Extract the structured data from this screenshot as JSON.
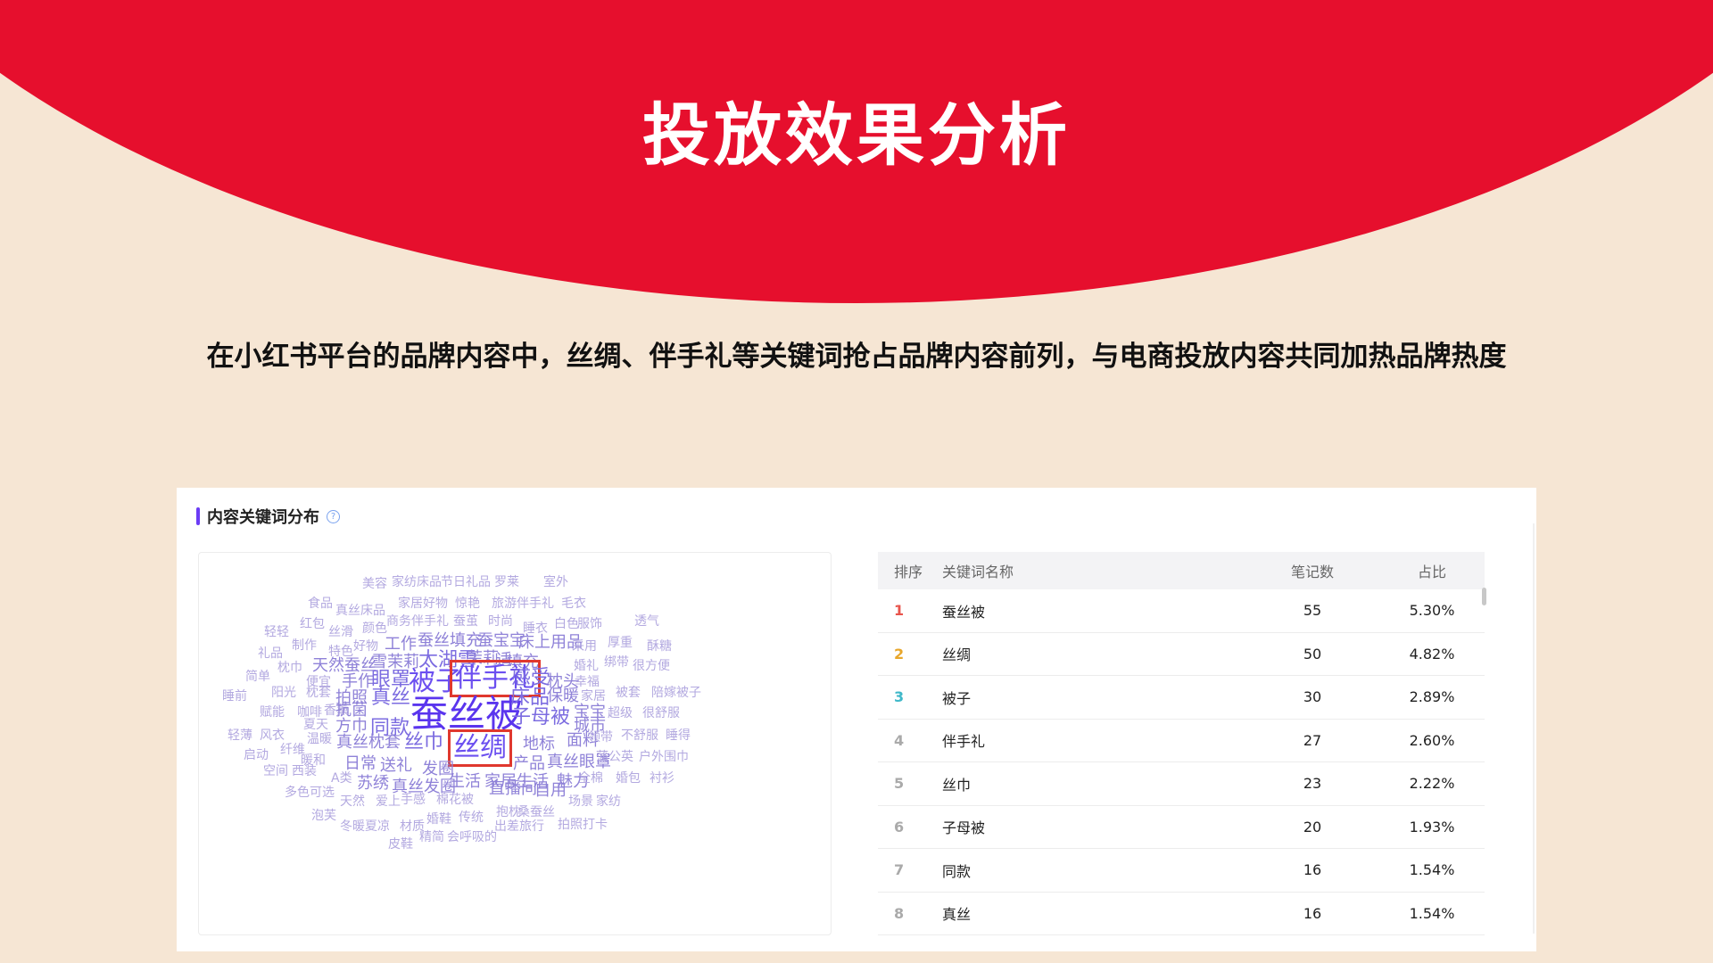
{
  "title": "投放效果分析",
  "subtitle": "在小红书平台的品牌内容中，丝绸、伴手礼等关键词抢占品牌内容前列，与电商投放内容共同加热品牌热度",
  "panel": {
    "title": "内容关键词分布",
    "help_icon": "question-circle-icon"
  },
  "colors": {
    "header_red": "#e60f2d",
    "background": "#f6e6d4",
    "accent_purple": "#6b3cf5",
    "highlight_box": "#e0382e"
  },
  "word_cloud": {
    "words": [
      {
        "t": "美容",
        "w": 1
      },
      {
        "t": "家纺床品",
        "w": 1
      },
      {
        "t": "节日礼品",
        "w": 1
      },
      {
        "t": "罗莱",
        "w": 1
      },
      {
        "t": "室外",
        "w": 1
      },
      {
        "t": "食品",
        "w": 1
      },
      {
        "t": "真丝床品",
        "w": 1
      },
      {
        "t": "家居好物",
        "w": 1
      },
      {
        "t": "惊艳",
        "w": 1
      },
      {
        "t": "旅游伴手礼",
        "w": 1
      },
      {
        "t": "毛衣",
        "w": 1
      },
      {
        "t": "轻轻",
        "w": 1
      },
      {
        "t": "红包",
        "w": 1
      },
      {
        "t": "商务伴手礼",
        "w": 1
      },
      {
        "t": "蚕茧",
        "w": 1
      },
      {
        "t": "时尚",
        "w": 1
      },
      {
        "t": "透气",
        "w": 1
      },
      {
        "t": "丝滑",
        "w": 1
      },
      {
        "t": "颜色",
        "w": 1
      },
      {
        "t": "睡衣",
        "w": 1
      },
      {
        "t": "白色",
        "w": 1
      },
      {
        "t": "服饰",
        "w": 1
      },
      {
        "t": "礼品",
        "w": 1
      },
      {
        "t": "制作",
        "w": 1
      },
      {
        "t": "好物",
        "w": 1
      },
      {
        "t": "工作",
        "w": 2
      },
      {
        "t": "蚕丝填充",
        "w": 2
      },
      {
        "t": "蚕宝宝",
        "w": 2
      },
      {
        "t": "床上用品",
        "w": 2
      },
      {
        "t": "厚重",
        "w": 1
      },
      {
        "t": "特色",
        "w": 1
      },
      {
        "t": "采用",
        "w": 1
      },
      {
        "t": "酥糖",
        "w": 1
      },
      {
        "t": "枕巾",
        "w": 1
      },
      {
        "t": "天然蚕丝",
        "w": 2
      },
      {
        "t": "雪茉莉",
        "w": 2
      },
      {
        "t": "太湖雪",
        "w": 3
      },
      {
        "t": "茉莉",
        "w": 2
      },
      {
        "t": "适",
        "w": 2
      },
      {
        "t": "填充",
        "w": 2
      },
      {
        "t": "婚礼",
        "w": 1
      },
      {
        "t": "绑带",
        "w": 1
      },
      {
        "t": "很方便",
        "w": 1
      },
      {
        "t": "简单",
        "w": 1
      },
      {
        "t": "便宜",
        "w": 1
      },
      {
        "t": "手作",
        "w": 2
      },
      {
        "t": "眼罩",
        "w": 3
      },
      {
        "t": "被子",
        "w": 4
      },
      {
        "t": "伴手礼",
        "w": 4
      },
      {
        "t": "感受",
        "w": 3
      },
      {
        "t": "枕头",
        "w": 2
      },
      {
        "t": "幸福",
        "w": 1
      },
      {
        "t": "睡前",
        "w": 1
      },
      {
        "t": "阳光",
        "w": 1
      },
      {
        "t": "枕套",
        "w": 1
      },
      {
        "t": "拍照",
        "w": 2
      },
      {
        "t": "真丝",
        "w": 3
      },
      {
        "t": "蚕丝被",
        "w": 5
      },
      {
        "t": "床品",
        "w": 3
      },
      {
        "t": "保暖",
        "w": 2
      },
      {
        "t": "家居",
        "w": 1
      },
      {
        "t": "被套",
        "w": 1
      },
      {
        "t": "陪嫁被子",
        "w": 1
      },
      {
        "t": "赋能",
        "w": 1
      },
      {
        "t": "咖啡",
        "w": 1
      },
      {
        "t": "香薰",
        "w": 1
      },
      {
        "t": "抗菌",
        "w": 2
      },
      {
        "t": "子母被",
        "w": 3
      },
      {
        "t": "宝宝",
        "w": 2
      },
      {
        "t": "超级",
        "w": 1
      },
      {
        "t": "很舒服",
        "w": 1
      },
      {
        "t": "夏天",
        "w": 1
      },
      {
        "t": "方巾",
        "w": 2
      },
      {
        "t": "同款",
        "w": 3
      },
      {
        "t": "城市",
        "w": 2
      },
      {
        "t": "轻薄",
        "w": 1
      },
      {
        "t": "风衣",
        "w": 1
      },
      {
        "t": "温暖",
        "w": 1
      },
      {
        "t": "真丝枕套",
        "w": 2
      },
      {
        "t": "丝巾",
        "w": 3
      },
      {
        "t": "丝绸",
        "w": 4
      },
      {
        "t": "地标",
        "w": 2
      },
      {
        "t": "面料",
        "w": 2
      },
      {
        "t": "领带",
        "w": 1
      },
      {
        "t": "不舒服",
        "w": 1
      },
      {
        "t": "睡得",
        "w": 1
      },
      {
        "t": "纤维",
        "w": 1
      },
      {
        "t": "启动",
        "w": 1
      },
      {
        "t": "暖和",
        "w": 1
      },
      {
        "t": "日常",
        "w": 2
      },
      {
        "t": "送礼",
        "w": 2
      },
      {
        "t": "发圈",
        "w": 2
      },
      {
        "t": "产品",
        "w": 2
      },
      {
        "t": "真丝眼罩",
        "w": 2
      },
      {
        "t": "蒲公英",
        "w": 1
      },
      {
        "t": "户外围巾",
        "w": 1
      },
      {
        "t": "空间",
        "w": 1
      },
      {
        "t": "西装",
        "w": 1
      },
      {
        "t": "A类",
        "w": 1
      },
      {
        "t": "苏绣",
        "w": 2
      },
      {
        "t": "真丝发圈",
        "w": 2
      },
      {
        "t": "生活",
        "w": 2
      },
      {
        "t": "家居生活",
        "w": 2
      },
      {
        "t": "魅力",
        "w": 2
      },
      {
        "t": "全棉",
        "w": 1
      },
      {
        "t": "婚包",
        "w": 1
      },
      {
        "t": "衬衫",
        "w": 1
      },
      {
        "t": "多色可选",
        "w": 1
      },
      {
        "t": "直播间",
        "w": 2
      },
      {
        "t": "自用",
        "w": 2
      },
      {
        "t": "天然",
        "w": 1
      },
      {
        "t": "爱上",
        "w": 1
      },
      {
        "t": "手感",
        "w": 1
      },
      {
        "t": "棉花被",
        "w": 1
      },
      {
        "t": "场景",
        "w": 1
      },
      {
        "t": "家纺",
        "w": 1
      },
      {
        "t": "泡芙",
        "w": 1
      },
      {
        "t": "抱枕",
        "w": 1
      },
      {
        "t": "桑蚕丝",
        "w": 1
      },
      {
        "t": "冬暖夏凉",
        "w": 1
      },
      {
        "t": "材质",
        "w": 1
      },
      {
        "t": "婚鞋",
        "w": 1
      },
      {
        "t": "传统",
        "w": 1
      },
      {
        "t": "出差旅行",
        "w": 1
      },
      {
        "t": "拍照打卡",
        "w": 1
      },
      {
        "t": "皮鞋",
        "w": 1
      },
      {
        "t": "精简",
        "w": 1
      },
      {
        "t": "会呼吸的",
        "w": 1
      }
    ],
    "highlighted": [
      "伴手礼",
      "丝绸"
    ]
  },
  "table": {
    "headers": {
      "rank": "排序",
      "name": "关键词名称",
      "count": "笔记数",
      "ratio": "占比"
    },
    "rows": [
      {
        "rank": "1",
        "name": "蚕丝被",
        "count": "55",
        "ratio": "5.30%",
        "color": "#e8544c"
      },
      {
        "rank": "2",
        "name": "丝绸",
        "count": "50",
        "ratio": "4.82%",
        "color": "#e8a72c"
      },
      {
        "rank": "3",
        "name": "被子",
        "count": "30",
        "ratio": "2.89%",
        "color": "#3fb8c9"
      },
      {
        "rank": "4",
        "name": "伴手礼",
        "count": "27",
        "ratio": "2.60%",
        "color": "#aaaaaa"
      },
      {
        "rank": "5",
        "name": "丝巾",
        "count": "23",
        "ratio": "2.22%",
        "color": "#aaaaaa"
      },
      {
        "rank": "6",
        "name": "子母被",
        "count": "20",
        "ratio": "1.93%",
        "color": "#aaaaaa"
      },
      {
        "rank": "7",
        "name": "同款",
        "count": "16",
        "ratio": "1.54%",
        "color": "#aaaaaa"
      },
      {
        "rank": "8",
        "name": "真丝",
        "count": "16",
        "ratio": "1.54%",
        "color": "#aaaaaa"
      }
    ]
  }
}
